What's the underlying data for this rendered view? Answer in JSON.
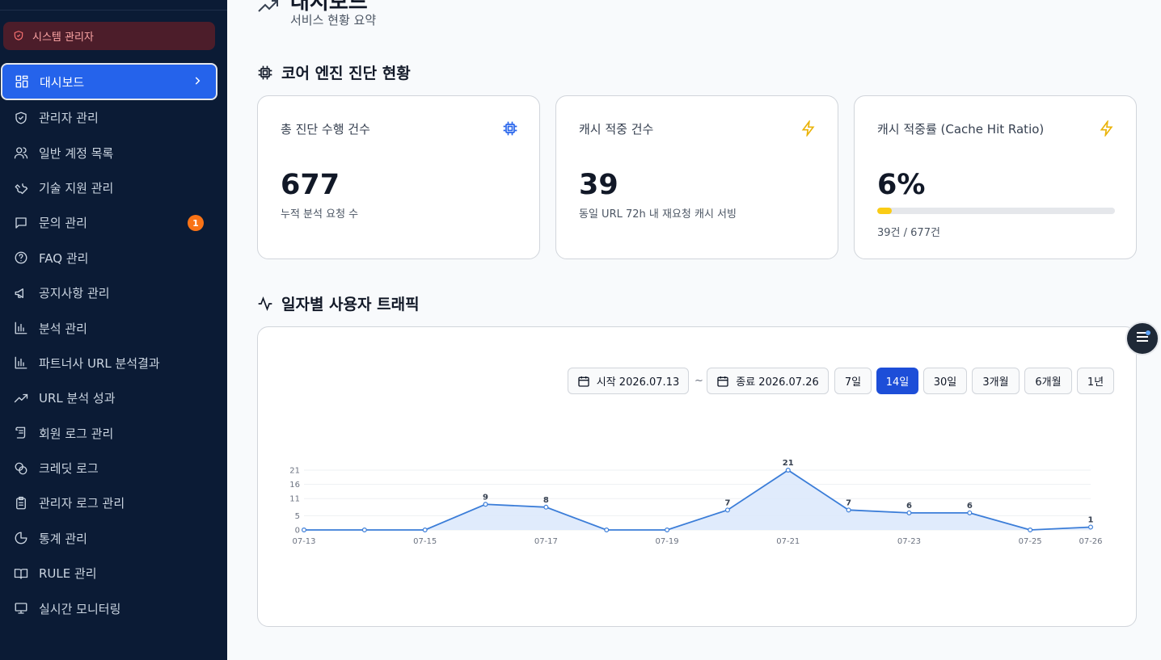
{
  "sidebar": {
    "role_badge": "시스템 관리자",
    "items": [
      {
        "label": "대시보드",
        "icon": "grid-icon",
        "active": true
      },
      {
        "label": "관리자 관리",
        "icon": "shield-icon"
      },
      {
        "label": "일반 계정 목록",
        "icon": "users-icon"
      },
      {
        "label": "기술 지원 관리",
        "icon": "wrench-icon"
      },
      {
        "label": "문의 관리",
        "icon": "message-icon",
        "badge": "1"
      },
      {
        "label": "FAQ 관리",
        "icon": "help-circle-icon"
      },
      {
        "label": "공지사항 관리",
        "icon": "megaphone-icon"
      },
      {
        "label": "분석 관리",
        "icon": "bar-chart-icon"
      },
      {
        "label": "파트너사 URL 분석결과",
        "icon": "bar-chart-icon"
      },
      {
        "label": "URL 분석 성과",
        "icon": "trending-up-icon"
      },
      {
        "label": "회원 로그 관리",
        "icon": "scroll-icon"
      },
      {
        "label": "크레딧 로그",
        "icon": "coins-icon"
      },
      {
        "label": "관리자 로그 관리",
        "icon": "clipboard-icon"
      },
      {
        "label": "통계 관리",
        "icon": "pie-chart-icon"
      },
      {
        "label": "RULE 관리",
        "icon": "book-icon"
      },
      {
        "label": "실시간 모니터링",
        "icon": "monitor-icon"
      }
    ]
  },
  "header": {
    "title": "대시보드",
    "subtitle": "서비스 현황 요약"
  },
  "engine_section": {
    "title": "코어 엔진 진단 현황",
    "cards": [
      {
        "label": "총 진단 수행 건수",
        "value": "677",
        "desc": "누적 분석 요청 수",
        "icon": "cpu-icon",
        "icon_color": "#2563eb"
      },
      {
        "label": "캐시 적중 건수",
        "value": "39",
        "desc": "동일 URL 72h 내 재요청 캐시 서빙",
        "icon": "zap-icon",
        "icon_color": "#eab308"
      },
      {
        "label": "캐시 적중률 (Cache Hit Ratio)",
        "value": "6%",
        "progress_fraction": 0.06,
        "foot": "39건 / 677건",
        "icon": "zap-icon",
        "icon_color": "#eab308"
      }
    ]
  },
  "traffic_section": {
    "title": "일자별 사용자 트래픽",
    "start_label": "시작 2026.07.13",
    "end_label": "종료 2026.07.26",
    "range_sep": "~",
    "ranges": [
      "7일",
      "14일",
      "30일",
      "3개월",
      "6개월",
      "1년"
    ],
    "active_range": "14일"
  },
  "chart_data": {
    "type": "area",
    "x": [
      "07-13",
      "07-14",
      "07-15",
      "07-16",
      "07-17",
      "07-18",
      "07-19",
      "07-20",
      "07-21",
      "07-22",
      "07-23",
      "07-24",
      "07-25",
      "07-26"
    ],
    "x_tick_labels": [
      "07-13",
      "07-15",
      "07-17",
      "07-19",
      "07-21",
      "07-23",
      "07-25",
      "07-26"
    ],
    "values": [
      0,
      0,
      0,
      9,
      8,
      0,
      0,
      7,
      21,
      7,
      6,
      6,
      0,
      1
    ],
    "data_labels": [
      null,
      null,
      null,
      "9",
      "8",
      null,
      null,
      "7",
      "21",
      "7",
      "6",
      "6",
      null,
      "1"
    ],
    "y_ticks": [
      0,
      5,
      11,
      16,
      21
    ],
    "ylim": [
      0,
      21
    ],
    "line_color": "#3b7dd8",
    "fill_color": "#dbe7fb",
    "grid": true
  },
  "fab": {
    "icon": "menu-icon"
  }
}
